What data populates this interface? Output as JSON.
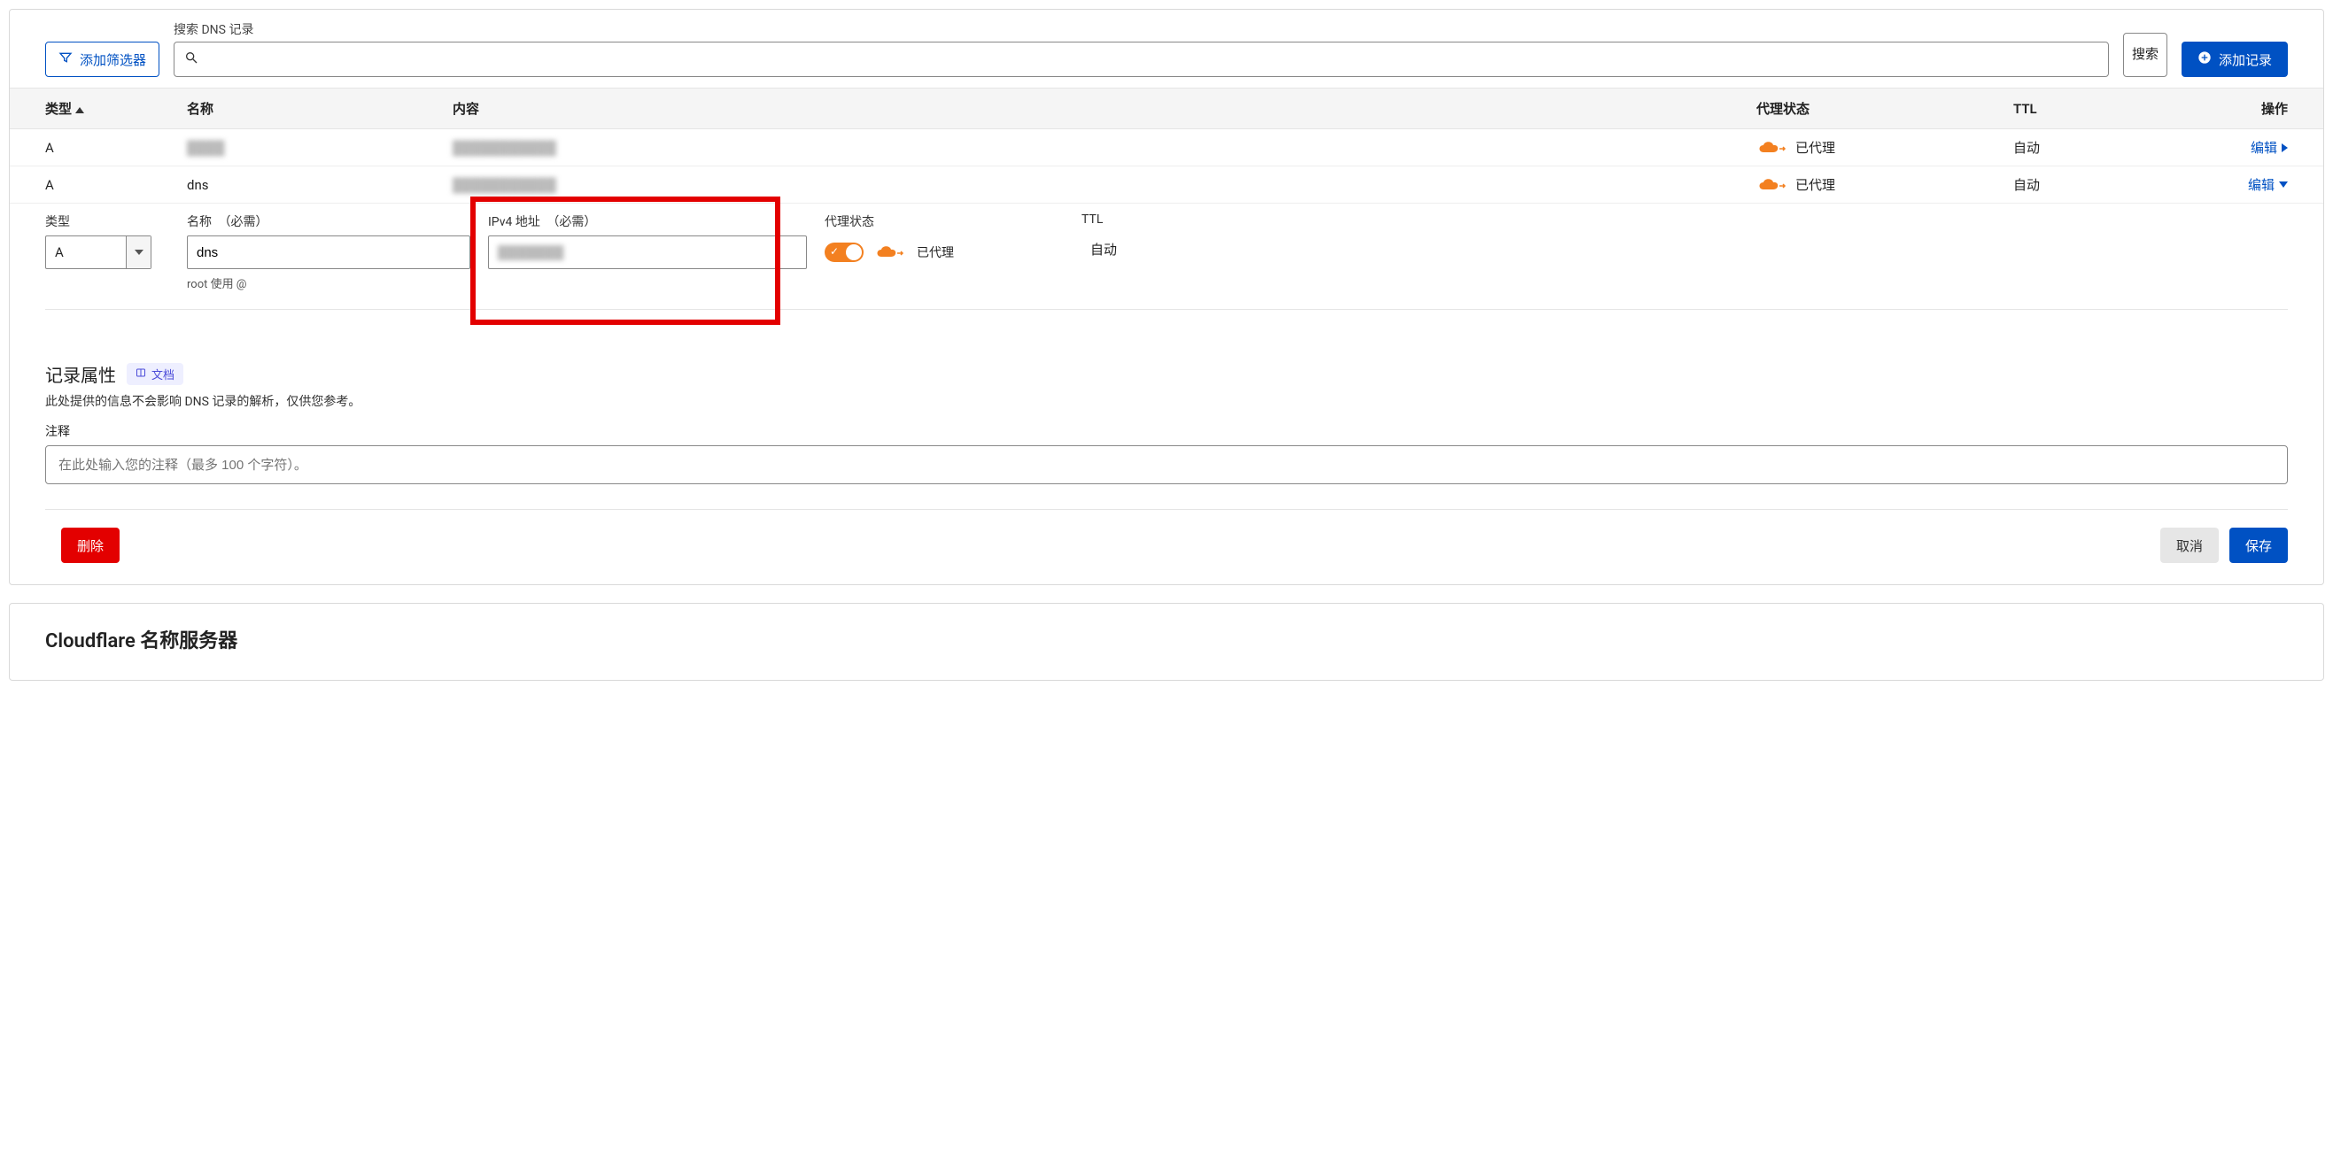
{
  "toolbar": {
    "add_filter": "添加筛选器",
    "search_label": "搜索 DNS 记录",
    "search_submit": "搜索",
    "add_record": "添加记录"
  },
  "table": {
    "headers": {
      "type": "类型",
      "name": "名称",
      "content": "内容",
      "proxy": "代理状态",
      "ttl": "TTL",
      "action": "操作"
    },
    "rows": [
      {
        "type": "A",
        "name": "████",
        "content": "███████████",
        "proxy": "已代理",
        "ttl": "自动",
        "action": "编辑",
        "expanded": false
      },
      {
        "type": "A",
        "name": "dns",
        "content": "███████████",
        "proxy": "已代理",
        "ttl": "自动",
        "action": "编辑",
        "expanded": true
      }
    ]
  },
  "editor": {
    "type_label": "类型",
    "type_value": "A",
    "name_label": "名称",
    "name_value": "dns",
    "name_hint": "root 使用 @",
    "ipv4_label": "IPv4 地址",
    "ipv4_value": "███████",
    "required": "（必需）",
    "proxy_label": "代理状态",
    "proxy_status": "已代理",
    "ttl_label": "TTL",
    "ttl_value": "自动"
  },
  "attrs": {
    "title": "记录属性",
    "docs_badge": "文档",
    "desc": "此处提供的信息不会影响 DNS 记录的解析，仅供您参考。",
    "notes_label": "注释",
    "notes_placeholder": "在此处输入您的注释（最多 100 个字符）。"
  },
  "buttons": {
    "delete": "删除",
    "cancel": "取消",
    "save": "保存"
  },
  "nameservers": {
    "title": "Cloudflare 名称服务器"
  }
}
